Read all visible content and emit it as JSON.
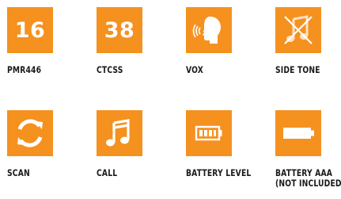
{
  "colors": {
    "tile": "#f5911f",
    "icon": "#ffffff",
    "text": "#1a1a1a"
  },
  "features": [
    {
      "tile_text": "16",
      "label": "PMR446",
      "icon": "number"
    },
    {
      "tile_text": "38",
      "label": "CTCSS",
      "icon": "number"
    },
    {
      "label": "VOX",
      "icon": "speaking-head-icon"
    },
    {
      "label": "SIDE TONE",
      "icon": "muted-music-note-icon"
    },
    {
      "label": "SCAN",
      "icon": "refresh-arrows-icon"
    },
    {
      "label": "CALL",
      "icon": "music-note-icon"
    },
    {
      "label": "BATTERY LEVEL",
      "icon": "battery-level-icon"
    },
    {
      "label": "BATTERY AAA",
      "label_line2": "(NOT INCLUDED)",
      "icon": "battery-full-icon"
    }
  ]
}
